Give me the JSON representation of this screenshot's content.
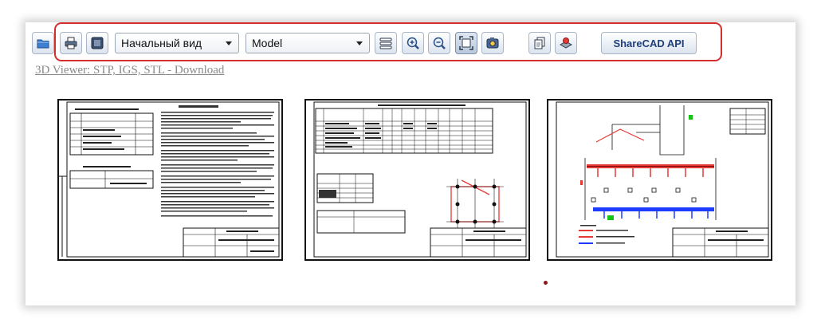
{
  "toolbar": {
    "open_icon": "folder-open-icon",
    "print_icon": "printer-icon",
    "background_icon": "background-toggle-icon",
    "view_select": {
      "selected": "Начальный вид"
    },
    "layout_select": {
      "selected": "Model"
    },
    "layers_icon": "layers-icon",
    "zoom_in_icon": "zoom-in-icon",
    "zoom_out_icon": "zoom-out-icon",
    "fit_icon": "fit-to-screen-icon",
    "snapshot_icon": "snapshot-icon",
    "copy_icon": "copy-icon",
    "render_icon": "render-icon",
    "api_button_label": "ShareCAD API"
  },
  "download_link": "3D Viewer: STP, IGS, STL - Download",
  "colors": {
    "highlight_frame": "#d32f2f",
    "api_text": "#1f3f7a",
    "drawing_red": "#e53935",
    "drawing_blue": "#1e3cff",
    "drawing_green": "#17c217"
  }
}
